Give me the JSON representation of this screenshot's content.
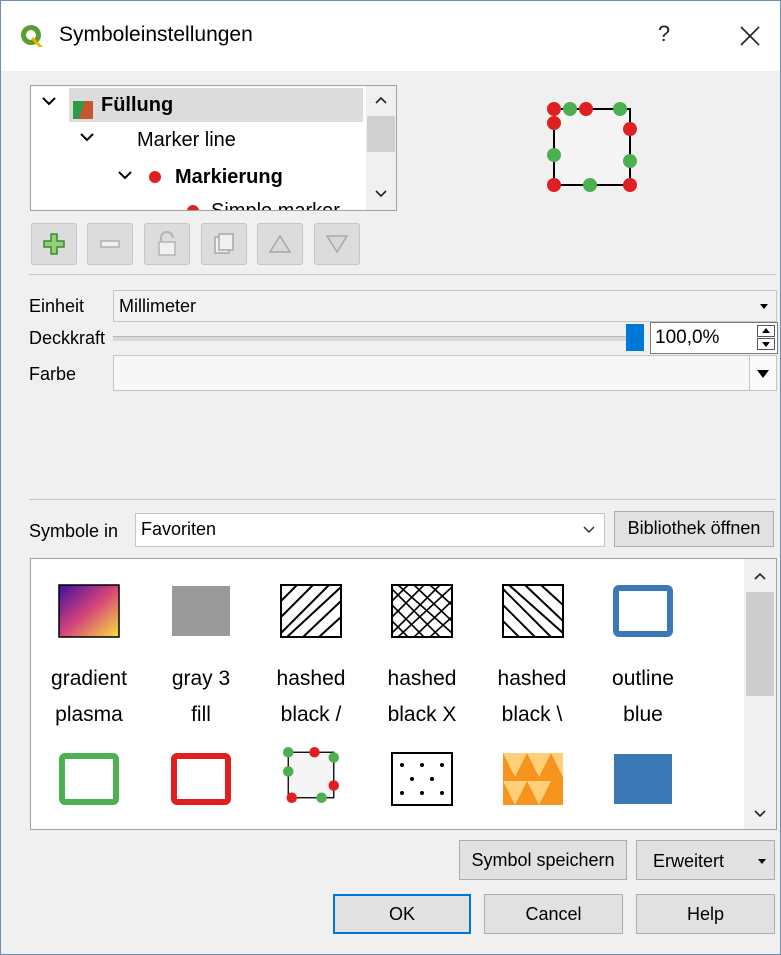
{
  "window": {
    "title": "Symboleinstellungen",
    "help_glyph": "?",
    "close_glyph": "✕"
  },
  "tree": {
    "items": [
      {
        "label": "Füllung",
        "bold": true
      },
      {
        "label": "Marker line",
        "bold": false
      },
      {
        "label": "Markierung",
        "bold": true
      },
      {
        "label": "Simple marker",
        "bold": false
      }
    ]
  },
  "toolbar": {
    "buttons": [
      "add-layer",
      "remove-layer",
      "lock-layer",
      "duplicate-layer",
      "move-up",
      "move-down"
    ]
  },
  "props": {
    "unit_label": "Einheit",
    "unit_value": "Millimeter",
    "opacity_label": "Deckkraft",
    "opacity_value": "100,0%",
    "opacity_fraction": 1.0,
    "color_label": "Farbe"
  },
  "library": {
    "symbols_in_label": "Symbole in",
    "group_value": "Favoriten",
    "open_library_label": "Bibliothek öffnen",
    "symbols": [
      {
        "line1": "gradient",
        "line2": "plasma",
        "icon": "gradient-plasma-icon"
      },
      {
        "line1": "gray 3",
        "line2": "fill",
        "icon": "gray-fill-icon"
      },
      {
        "line1": "hashed",
        "line2": "black /",
        "icon": "hashed-forward-icon"
      },
      {
        "line1": "hashed",
        "line2": "black X",
        "icon": "hashed-cross-icon"
      },
      {
        "line1": "hashed",
        "line2": "black \\",
        "icon": "hashed-back-icon"
      },
      {
        "line1": "outline",
        "line2": "blue",
        "icon": "outline-blue-icon"
      }
    ],
    "second_row_icons": [
      "outline-green-icon",
      "outline-red-icon",
      "marker-line-icon",
      "dotted-fill-icon",
      "orange-triangles-icon",
      "blue-fill-icon"
    ]
  },
  "actions": {
    "save_symbol_label": "Symbol speichern",
    "advanced_label": "Erweitert",
    "ok_label": "OK",
    "cancel_label": "Cancel",
    "help_label": "Help"
  },
  "colors": {
    "accent": "#0078d7",
    "marker_red": "#e02020",
    "marker_green": "#4caf50"
  }
}
